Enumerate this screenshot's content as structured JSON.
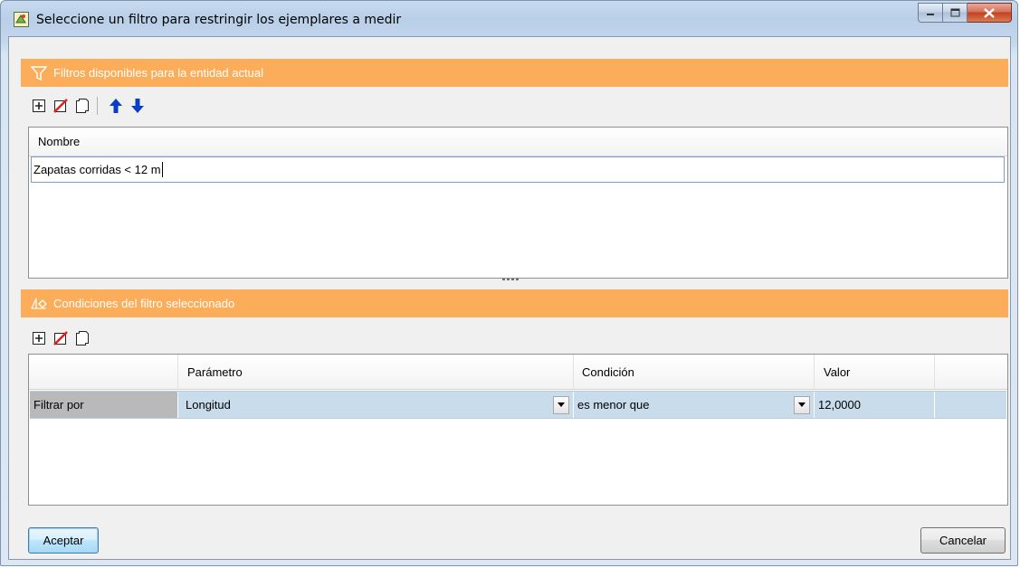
{
  "window": {
    "title": "Seleccione un filtro para restringir los ejemplares a medir"
  },
  "filters_section": {
    "header": "Filtros disponibles para la entidad actual",
    "toolbar": [
      "add-icon",
      "delete-icon",
      "copy-icon",
      "move-up-icon",
      "move-down-icon"
    ],
    "column_header": "Nombre",
    "rows": [
      {
        "name": "Zapatas corridas < 12 m"
      }
    ]
  },
  "conditions_section": {
    "header": "Condiciones del filtro seleccionado",
    "toolbar": [
      "add-icon",
      "delete-icon",
      "copy-icon"
    ],
    "columns": [
      "",
      "Parámetro",
      "Condición",
      "Valor",
      ""
    ],
    "rows": [
      {
        "label": "Filtrar por",
        "parametro": "Longitud",
        "condicion": "es menor que",
        "valor": "12,0000"
      }
    ]
  },
  "buttons": {
    "accept": "Aceptar",
    "cancel": "Cancelar"
  },
  "colors": {
    "section_header": "#fbad5a",
    "row_selected": "#c9dcec",
    "label_cell": "#b9b9b9"
  }
}
